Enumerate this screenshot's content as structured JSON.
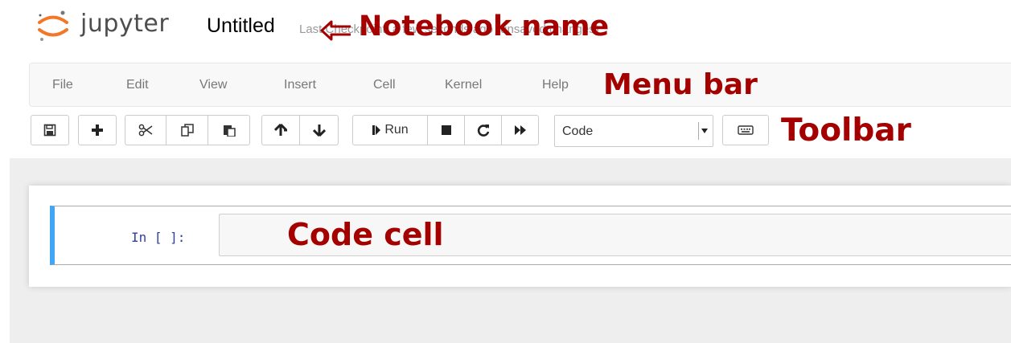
{
  "header": {
    "logo_text": "jupyter",
    "notebook_name": "Untitled",
    "checkpoint_text": "Last Checkpoint: a few seconds ago (unsaved changes)"
  },
  "menubar": {
    "items": [
      "File",
      "Edit",
      "View",
      "Insert",
      "Cell",
      "Kernel",
      "Help"
    ]
  },
  "toolbar": {
    "buttons": [
      "save-icon",
      "plus-icon",
      "cut-icon",
      "copy-icon",
      "paste-icon",
      "arrow-up-icon",
      "arrow-down-icon",
      "step-forward-icon",
      "stop-icon",
      "refresh-icon",
      "fast-forward-icon",
      "keyboard-icon"
    ],
    "run_label": "Run",
    "cell_type_value": "Code"
  },
  "cell": {
    "prompt": "In [ ]:"
  },
  "annotations": {
    "notebook_name": "Notebook name",
    "menu_bar": "Menu bar",
    "toolbar": "Toolbar",
    "code_cell": "Code cell"
  },
  "colors": {
    "annotation": "#a50000",
    "jupyter_orange": "#f37726",
    "cell_selected_border": "#42a5f5",
    "prompt": "#303f9f"
  }
}
